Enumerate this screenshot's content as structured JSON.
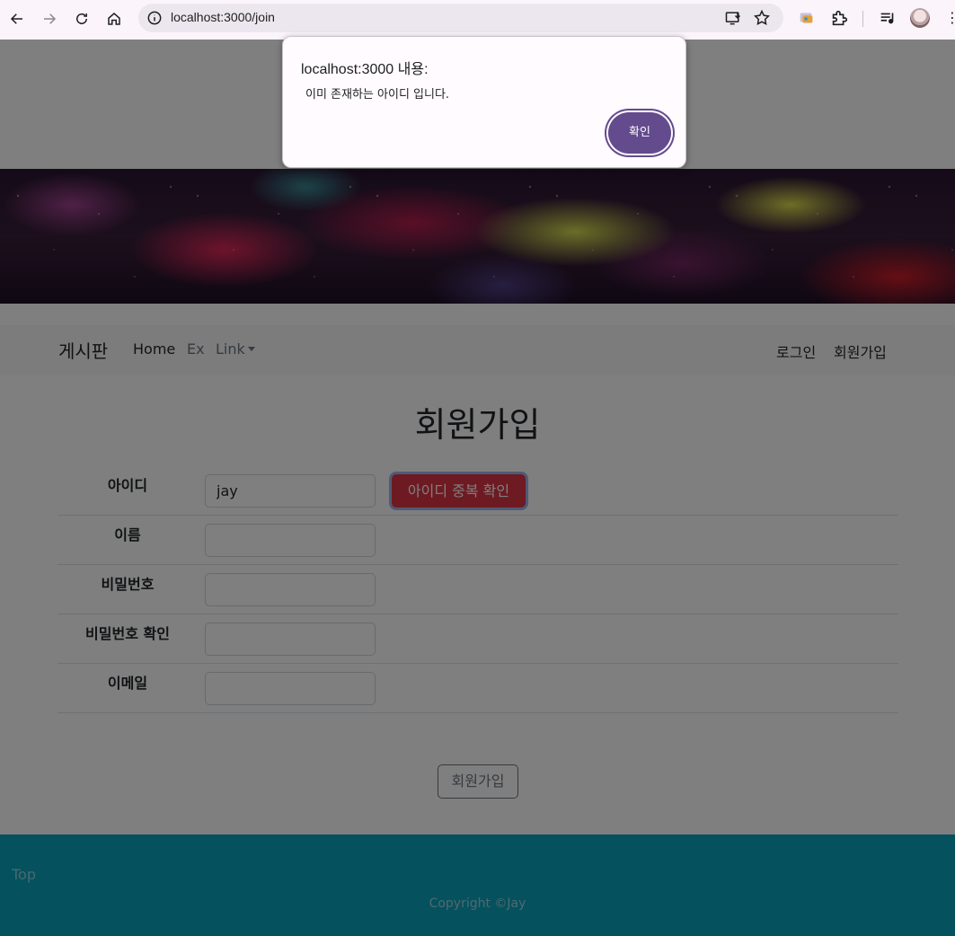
{
  "browser": {
    "url": "localhost:3000/join",
    "icons": [
      "back-icon",
      "forward-icon",
      "reload-icon",
      "home-icon",
      "site-info-icon",
      "install-app-icon",
      "bookmark-star-icon",
      "extension-puzzle-icon",
      "media-control-icon",
      "profile-avatar",
      "more-menu-icon"
    ]
  },
  "site": {
    "brand": "게시판",
    "nav": {
      "home": "Home",
      "ex": "Ex",
      "link": "Link"
    },
    "nav_right": {
      "login": "로그인",
      "join": "회원가입"
    }
  },
  "form": {
    "title": "회원가입",
    "fields": [
      {
        "label": "아이디",
        "value": "jay"
      },
      {
        "label": "이름",
        "value": ""
      },
      {
        "label": "비밀번호",
        "value": ""
      },
      {
        "label": "비밀번호 확인",
        "value": ""
      },
      {
        "label": "이메일",
        "value": ""
      }
    ],
    "dup_check_button": "아이디 중복 확인",
    "submit_button": "회원가입"
  },
  "footer": {
    "top_link": "Top",
    "copyright": "Copyright ©Jay"
  },
  "dialog": {
    "origin": "localhost:3000 내용:",
    "message": "이미 존재하는 아이디 입니다.",
    "ok_button": "확인",
    "accent": "#644b8d"
  },
  "colors": {
    "danger": "#dc3545",
    "footer": "#0ba3bd"
  }
}
